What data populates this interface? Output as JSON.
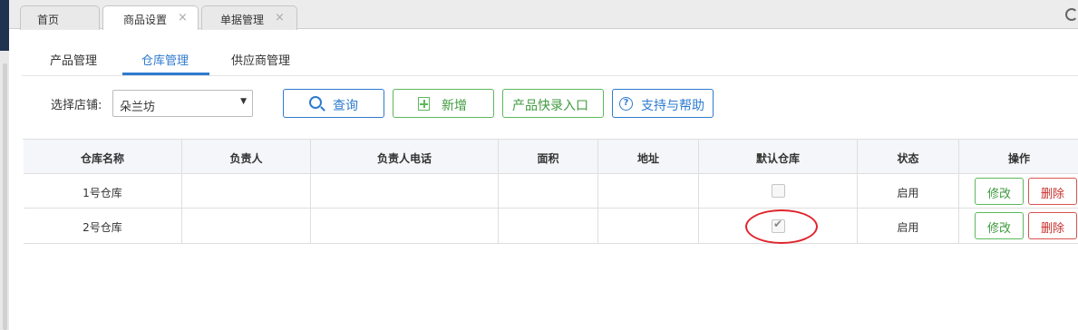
{
  "tabs": [
    {
      "label": "首页",
      "active": false,
      "closable": false
    },
    {
      "label": "商品设置",
      "active": true,
      "closable": true
    },
    {
      "label": "单据管理",
      "active": false,
      "closable": true
    }
  ],
  "close_glyph": "×",
  "subtabs": [
    {
      "label": "产品管理",
      "active": false
    },
    {
      "label": "仓库管理",
      "active": true
    },
    {
      "label": "供应商管理",
      "active": false
    }
  ],
  "filter": {
    "store_label": "选择店铺:",
    "store_value": "朵兰坊",
    "caret": "▼"
  },
  "toolbar": {
    "query_label": "查询",
    "add_label": "新增",
    "quick_entry_label": "产品快录入口",
    "help_label": "支持与帮助",
    "help_glyph": "?"
  },
  "table": {
    "columns": [
      "仓库名称",
      "负责人",
      "负责人电话",
      "面积",
      "地址",
      "默认仓库",
      "状态",
      "操作"
    ],
    "rows": [
      {
        "name": "1号仓库",
        "manager": "",
        "phone": "",
        "area": "",
        "address": "",
        "is_default": false,
        "status": "启用"
      },
      {
        "name": "2号仓库",
        "manager": "",
        "phone": "",
        "area": "",
        "address": "",
        "is_default": true,
        "status": "启用"
      }
    ],
    "edit_label": "修改",
    "delete_label": "删除",
    "check_glyph": "✔"
  },
  "colors": {
    "accent": "#2e7bcf",
    "success": "#5cb85c",
    "danger": "#d9534f",
    "annotation": "#e0242b"
  }
}
